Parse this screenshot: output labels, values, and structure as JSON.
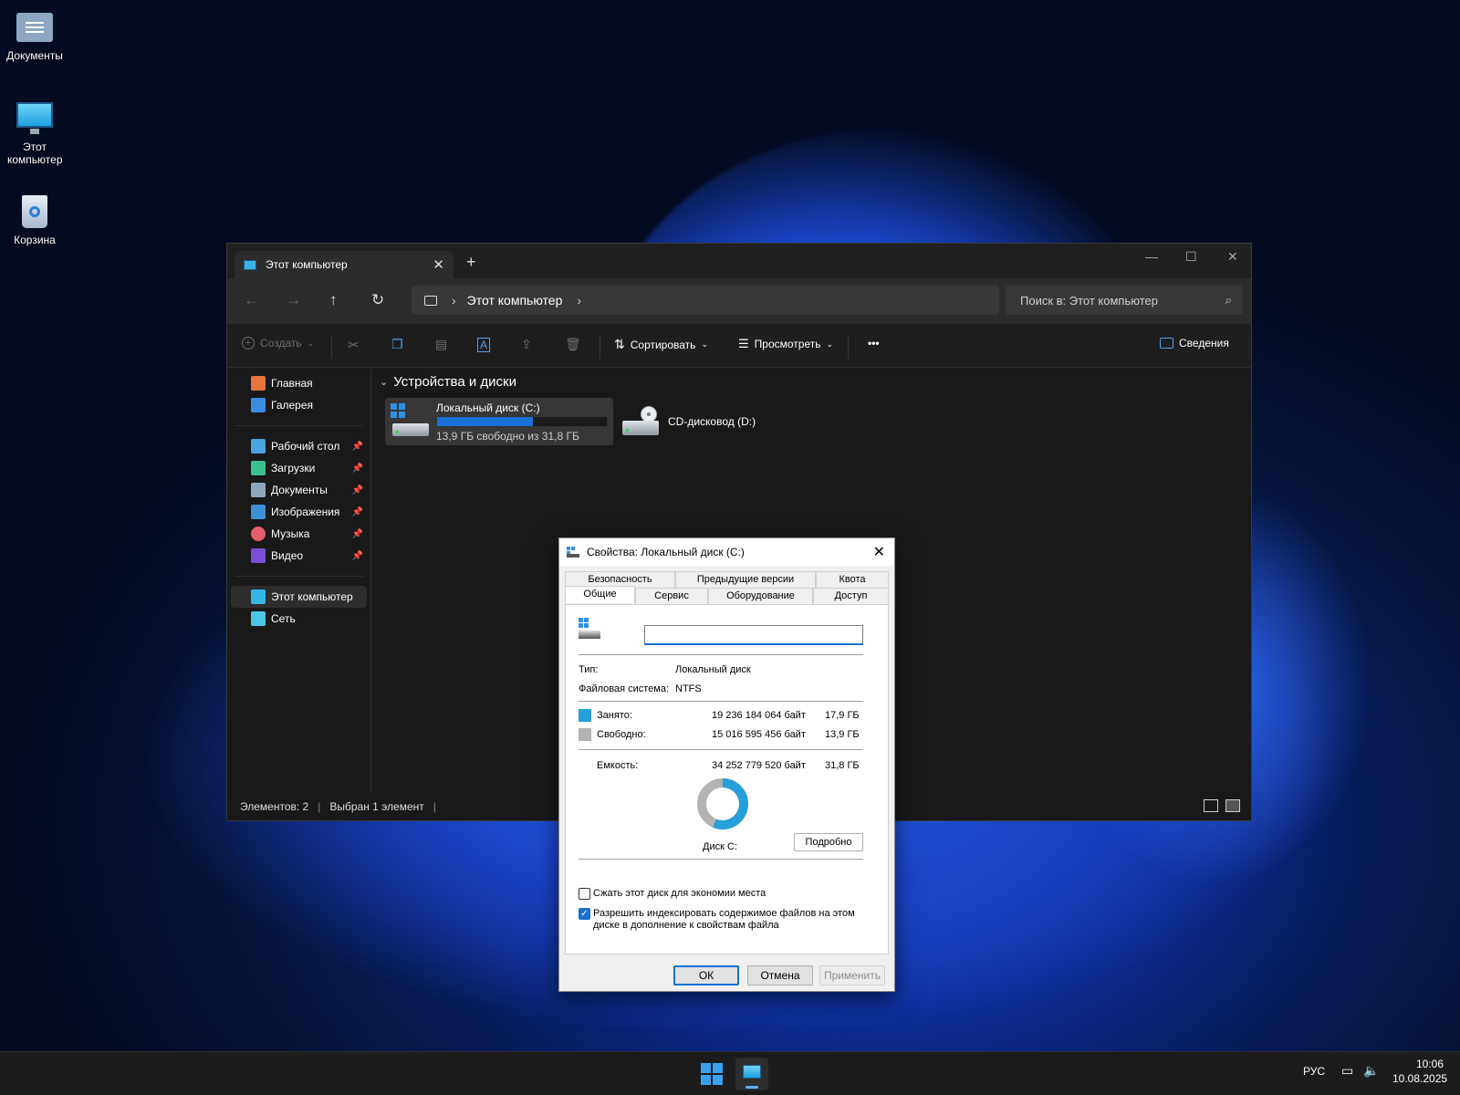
{
  "desktop": {
    "icons": [
      {
        "label": "Документы"
      },
      {
        "label": "Этот компьютер"
      },
      {
        "label": "Корзина"
      }
    ]
  },
  "explorer": {
    "tab_title": "Этот компьютер",
    "address": "Этот компьютер",
    "search_placeholder": "Поиск в: Этот компьютер",
    "commands": {
      "create": "Создать",
      "sort": "Сортировать",
      "view": "Просмотреть",
      "more": "•••",
      "details": "Сведения"
    },
    "sidebar": {
      "top": [
        {
          "label": "Главная",
          "color": "#e8743b"
        },
        {
          "label": "Галерея",
          "color": "#3a8de0"
        }
      ],
      "pinned": [
        {
          "label": "Рабочий стол",
          "color": "#4aa3df"
        },
        {
          "label": "Загрузки",
          "color": "#3cc08f"
        },
        {
          "label": "Документы",
          "color": "#8fa7bf"
        },
        {
          "label": "Изображения",
          "color": "#3b8fd9"
        },
        {
          "label": "Музыка",
          "color": "#e35d6a"
        },
        {
          "label": "Видео",
          "color": "#7a4fd6"
        }
      ],
      "bottom": [
        {
          "label": "Этот компьютер",
          "color": "#38b6e8"
        },
        {
          "label": "Сеть",
          "color": "#4dc7e8"
        }
      ]
    },
    "group_title": "Устройства и диски",
    "drives": {
      "c": {
        "name": "Локальный диск (C:)",
        "free_text": "13,9 ГБ свободно из 31,8 ГБ",
        "used_fraction": 0.563
      },
      "d": {
        "name": "CD-дисковод (D:)"
      }
    },
    "status": {
      "items": "Элементов: 2",
      "selected": "Выбран 1 элемент"
    }
  },
  "dialog": {
    "title": "Свойства: Локальный диск (C:)",
    "tabs_back": [
      "Безопасность",
      "Предыдущие версии",
      "Квота"
    ],
    "tabs_front": [
      "Общие",
      "Сервис",
      "Оборудование",
      "Доступ"
    ],
    "name_value": "",
    "type_label": "Тип:",
    "type_value": "Локальный диск",
    "fs_label": "Файловая система:",
    "fs_value": "NTFS",
    "used_label": "Занято:",
    "used_bytes": "19 236 184 064 байт",
    "used_gb": "17,9 ГБ",
    "free_label": "Свободно:",
    "free_bytes": "15 016 595 456 байт",
    "free_gb": "13,9 ГБ",
    "capacity_label": "Емкость:",
    "capacity_bytes": "34 252 779 520 байт",
    "capacity_gb": "31,8 ГБ",
    "disk_label": "Диск C:",
    "details_button": "Подробно",
    "used_color": "#26a0da",
    "free_color": "#b3b3b3",
    "compress_label": "Сжать этот диск для экономии места",
    "compress_checked": false,
    "index_label_1": "Разрешить индексировать содержимое файлов на этом",
    "index_label_2": "диске в дополнение к свойствам файла",
    "index_checked": true,
    "ok": "ОК",
    "cancel": "Отмена",
    "apply": "Применить"
  },
  "taskbar": {
    "language": "РУС",
    "time": "10:06",
    "date": "10.08.2025"
  }
}
